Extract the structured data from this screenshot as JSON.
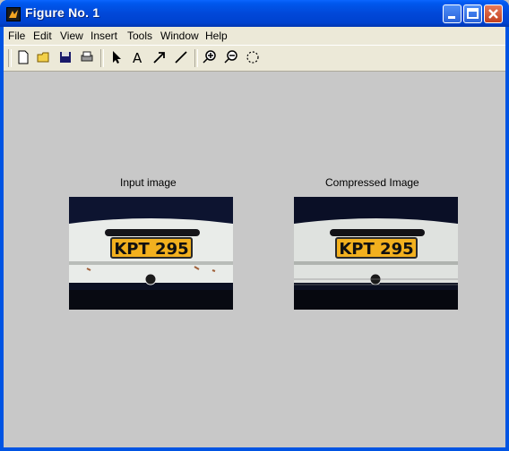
{
  "window": {
    "title": "Figure No. 1"
  },
  "menu": [
    "File",
    "Edit",
    "View",
    "Insert",
    "Tools",
    "Window",
    "Help"
  ],
  "toolbar": {
    "icons": [
      "new-file-icon",
      "open-folder-icon",
      "save-icon",
      "print-icon",
      "select-arrow-icon",
      "text-icon",
      "arrow-icon",
      "line-icon",
      "zoom-in-icon",
      "zoom-out-icon",
      "rotate-icon"
    ]
  },
  "axes": [
    {
      "title": "Input image",
      "plate": "KPT 295"
    },
    {
      "title": "Compressed Image",
      "plate": "KPT 295"
    }
  ],
  "colors": {
    "titlebar": "#0054e3",
    "figure_bg": "#c8c8c8",
    "plate": "#f2b01e"
  }
}
